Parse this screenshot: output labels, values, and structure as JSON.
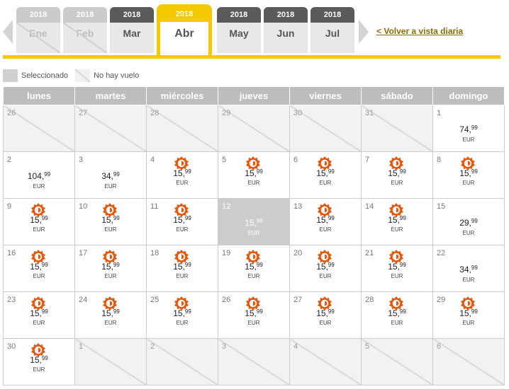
{
  "tabs": [
    {
      "year": "2018",
      "month": "Ene",
      "state": "disabled"
    },
    {
      "year": "2018",
      "month": "Feb",
      "state": "disabled"
    },
    {
      "year": "2018",
      "month": "Mar",
      "state": "normal"
    },
    {
      "year": "2018",
      "month": "Abr",
      "state": "active"
    },
    {
      "year": "2018",
      "month": "May",
      "state": "normal"
    },
    {
      "year": "2018",
      "month": "Jun",
      "state": "normal"
    },
    {
      "year": "2018",
      "month": "Jul",
      "state": "normal"
    }
  ],
  "back_link": "< Volver a vista diaria",
  "legend": {
    "selected": "Seleccionado",
    "no_flight": "No hay vuelo"
  },
  "weekdays": [
    "lunes",
    "martes",
    "miércoles",
    "jueves",
    "viernes",
    "sábado",
    "domingo"
  ],
  "currency": "EUR",
  "colors": {
    "accent": "#f6c800",
    "badge": "#e25a12",
    "header_gray": "#bdbdbd"
  },
  "weeks": [
    [
      {
        "day": "26",
        "empty": true
      },
      {
        "day": "27",
        "empty": true
      },
      {
        "day": "28",
        "empty": true
      },
      {
        "day": "29",
        "empty": true
      },
      {
        "day": "30",
        "empty": true
      },
      {
        "day": "31",
        "empty": true
      },
      {
        "day": "1",
        "int": "74,",
        "dec": "99",
        "sale": false
      }
    ],
    [
      {
        "day": "2",
        "int": "104,",
        "dec": "99",
        "sale": false
      },
      {
        "day": "3",
        "int": "34,",
        "dec": "99",
        "sale": false
      },
      {
        "day": "4",
        "int": "15,",
        "dec": "99",
        "sale": true
      },
      {
        "day": "5",
        "int": "15,",
        "dec": "99",
        "sale": true
      },
      {
        "day": "6",
        "int": "15,",
        "dec": "99",
        "sale": true
      },
      {
        "day": "7",
        "int": "15,",
        "dec": "99",
        "sale": true
      },
      {
        "day": "8",
        "int": "15,",
        "dec": "99",
        "sale": true
      }
    ],
    [
      {
        "day": "9",
        "int": "15,",
        "dec": "99",
        "sale": true
      },
      {
        "day": "10",
        "int": "15,",
        "dec": "99",
        "sale": true
      },
      {
        "day": "11",
        "int": "15,",
        "dec": "99",
        "sale": true
      },
      {
        "day": "12",
        "int": "15,",
        "dec": "99",
        "sale": false,
        "selected": true
      },
      {
        "day": "13",
        "int": "15,",
        "dec": "99",
        "sale": true
      },
      {
        "day": "14",
        "int": "15,",
        "dec": "99",
        "sale": true
      },
      {
        "day": "15",
        "int": "29,",
        "dec": "99",
        "sale": false
      }
    ],
    [
      {
        "day": "16",
        "int": "15,",
        "dec": "99",
        "sale": true
      },
      {
        "day": "17",
        "int": "15,",
        "dec": "99",
        "sale": true
      },
      {
        "day": "18",
        "int": "15,",
        "dec": "99",
        "sale": true
      },
      {
        "day": "19",
        "int": "15,",
        "dec": "99",
        "sale": true
      },
      {
        "day": "20",
        "int": "15,",
        "dec": "99",
        "sale": true
      },
      {
        "day": "21",
        "int": "15,",
        "dec": "99",
        "sale": true
      },
      {
        "day": "22",
        "int": "34,",
        "dec": "99",
        "sale": false
      }
    ],
    [
      {
        "day": "23",
        "int": "15,",
        "dec": "99",
        "sale": true
      },
      {
        "day": "24",
        "int": "15,",
        "dec": "99",
        "sale": true
      },
      {
        "day": "25",
        "int": "15,",
        "dec": "99",
        "sale": true
      },
      {
        "day": "26",
        "int": "15,",
        "dec": "99",
        "sale": true
      },
      {
        "day": "27",
        "int": "15,",
        "dec": "99",
        "sale": true
      },
      {
        "day": "28",
        "int": "15,",
        "dec": "99",
        "sale": true
      },
      {
        "day": "29",
        "int": "15,",
        "dec": "99",
        "sale": true
      }
    ],
    [
      {
        "day": "30",
        "int": "15,",
        "dec": "99",
        "sale": true
      },
      {
        "day": "1",
        "empty": true
      },
      {
        "day": "2",
        "empty": true
      },
      {
        "day": "3",
        "empty": true
      },
      {
        "day": "4",
        "empty": true
      },
      {
        "day": "5",
        "empty": true
      },
      {
        "day": "6",
        "empty": true
      }
    ]
  ]
}
